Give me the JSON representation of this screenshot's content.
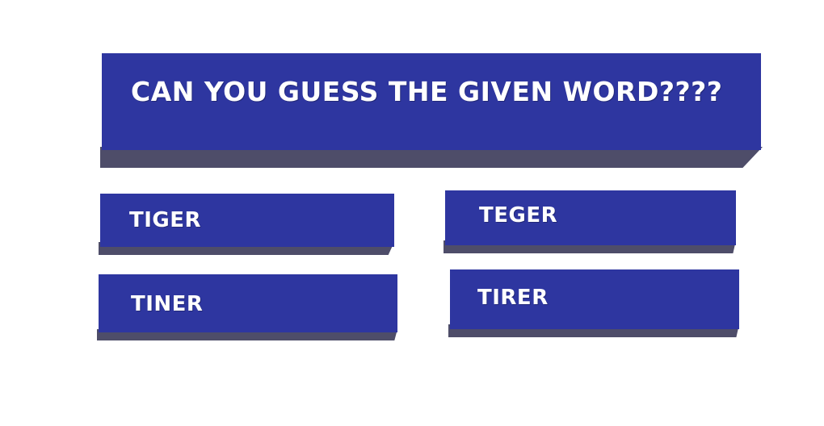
{
  "colors": {
    "face": "#2e36a0",
    "side": "#4e4d69",
    "text": "#ffffff",
    "background": "#ffffff"
  },
  "question": {
    "text": "CAN YOU GUESS THE GIVEN WORD????"
  },
  "options": [
    {
      "label": "TIGER"
    },
    {
      "label": "TEGER"
    },
    {
      "label": "TINER"
    },
    {
      "label": "TIRER"
    }
  ]
}
